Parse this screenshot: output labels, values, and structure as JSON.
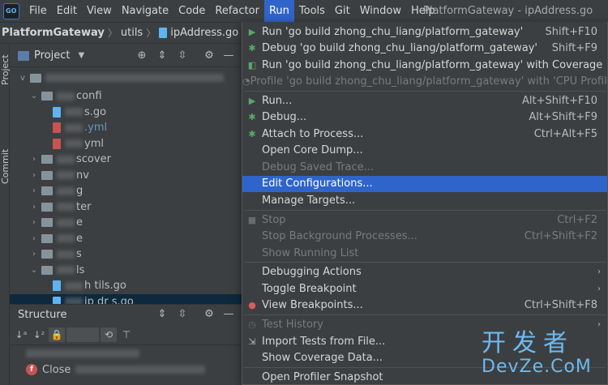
{
  "window": {
    "title": "PlatformGateway - ipAddress.go"
  },
  "menubar": {
    "items": [
      "File",
      "Edit",
      "View",
      "Navigate",
      "Code",
      "Refactor",
      "Run",
      "Tools",
      "Git",
      "Window",
      "Help"
    ],
    "active": "Run"
  },
  "breadcrumb": {
    "project": "PlatformGateway",
    "folder": "utils",
    "file": "ipAddress.go"
  },
  "sidebar": {
    "tabs": [
      "Project",
      "Commit"
    ]
  },
  "project_panel": {
    "title": "Project",
    "tree": [
      {
        "indent": 1,
        "chevron": "v",
        "icon": "folder",
        "label": "confi"
      },
      {
        "indent": 2,
        "chevron": "",
        "icon": "go",
        "label": "s.go"
      },
      {
        "indent": 2,
        "chevron": "",
        "icon": "yml",
        "label": ".yml"
      },
      {
        "indent": 2,
        "chevron": "",
        "icon": "yml",
        "label": "yml"
      },
      {
        "indent": 1,
        "chevron": ">",
        "icon": "folder",
        "label": "scover"
      },
      {
        "indent": 1,
        "chevron": ">",
        "icon": "folder",
        "label": "nv"
      },
      {
        "indent": 1,
        "chevron": ">",
        "icon": "folder",
        "label": "g"
      },
      {
        "indent": 1,
        "chevron": ">",
        "icon": "folder",
        "label": "ter"
      },
      {
        "indent": 1,
        "chevron": ">",
        "icon": "folder",
        "label": "e"
      },
      {
        "indent": 1,
        "chevron": ">",
        "icon": "folder",
        "label": "e"
      },
      {
        "indent": 1,
        "chevron": ">",
        "icon": "folder",
        "label": "s"
      },
      {
        "indent": 1,
        "chevron": "v",
        "icon": "folder",
        "label": "ls"
      },
      {
        "indent": 2,
        "chevron": "",
        "icon": "go",
        "label": "h  tils.go"
      },
      {
        "indent": 2,
        "chevron": "",
        "icon": "go",
        "label": "ip  dr  s.go"
      }
    ]
  },
  "structure_panel": {
    "title": "Structure",
    "rows": [
      {
        "badge": "",
        "label": ""
      },
      {
        "badge": "f",
        "label": "Close"
      }
    ]
  },
  "run_menu": {
    "items": [
      {
        "type": "item",
        "icon": "run",
        "label": "Run 'go build zhong_chu_liang/platform_gateway'",
        "shortcut": "Shift+F10",
        "disabled": false
      },
      {
        "type": "item",
        "icon": "debug",
        "label": "Debug 'go build zhong_chu_liang/platform_gateway'",
        "shortcut": "Shift+F9",
        "disabled": false
      },
      {
        "type": "item",
        "icon": "coverage",
        "label": "Run 'go build zhong_chu_liang/platform_gateway' with Coverage",
        "shortcut": "",
        "disabled": false
      },
      {
        "type": "item",
        "icon": "profile",
        "label": "Profile 'go build zhong_chu_liang/platform_gateway' with 'CPU Profiler'",
        "shortcut": "",
        "disabled": true
      },
      {
        "type": "sep"
      },
      {
        "type": "item",
        "icon": "run",
        "label": "Run...",
        "shortcut": "Alt+Shift+F10",
        "disabled": false
      },
      {
        "type": "item",
        "icon": "debug",
        "label": "Debug...",
        "shortcut": "Alt+Shift+F9",
        "disabled": false
      },
      {
        "type": "item",
        "icon": "attach",
        "label": "Attach to Process...",
        "shortcut": "Ctrl+Alt+F5",
        "disabled": false
      },
      {
        "type": "item",
        "icon": "",
        "label": "Open Core Dump...",
        "shortcut": "",
        "disabled": false
      },
      {
        "type": "item",
        "icon": "",
        "label": "Debug Saved Trace...",
        "shortcut": "",
        "disabled": true
      },
      {
        "type": "item",
        "icon": "",
        "label": "Edit Configurations...",
        "shortcut": "",
        "disabled": false,
        "highlight": true
      },
      {
        "type": "item",
        "icon": "",
        "label": "Manage Targets...",
        "shortcut": "",
        "disabled": false
      },
      {
        "type": "sep"
      },
      {
        "type": "item",
        "icon": "stop",
        "label": "Stop",
        "shortcut": "Ctrl+F2",
        "disabled": true
      },
      {
        "type": "item",
        "icon": "",
        "label": "Stop Background Processes...",
        "shortcut": "Ctrl+Shift+F2",
        "disabled": true
      },
      {
        "type": "item",
        "icon": "",
        "label": "Show Running List",
        "shortcut": "",
        "disabled": true
      },
      {
        "type": "sep"
      },
      {
        "type": "item",
        "icon": "",
        "label": "Debugging Actions",
        "shortcut": "",
        "disabled": false,
        "submenu": true
      },
      {
        "type": "item",
        "icon": "",
        "label": "Toggle Breakpoint",
        "shortcut": "",
        "disabled": false,
        "submenu": true
      },
      {
        "type": "item",
        "icon": "breakpoints",
        "label": "View Breakpoints...",
        "shortcut": "Ctrl+Shift+F8",
        "disabled": false
      },
      {
        "type": "sep"
      },
      {
        "type": "item",
        "icon": "history",
        "label": "Test History",
        "shortcut": "",
        "disabled": true,
        "submenu": true
      },
      {
        "type": "item",
        "icon": "import",
        "label": "Import Tests from File...",
        "shortcut": "",
        "disabled": false
      },
      {
        "type": "item",
        "icon": "",
        "label": "Show Coverage Data...",
        "shortcut": "",
        "disabled": false
      },
      {
        "type": "sep"
      },
      {
        "type": "item",
        "icon": "",
        "label": "Open Profiler Snapshot",
        "shortcut": "",
        "disabled": false
      }
    ]
  },
  "watermark": {
    "cn": "开发者",
    "en": "DevZe.CoM"
  }
}
